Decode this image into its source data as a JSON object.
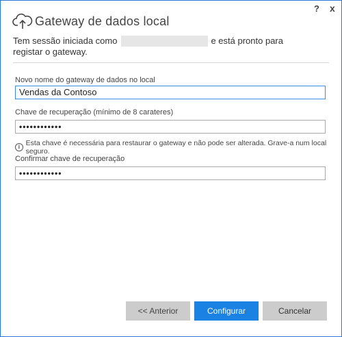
{
  "window": {
    "help_label": "?",
    "close_label": "x"
  },
  "header": {
    "title": "Gateway de dados local"
  },
  "signin": {
    "prefix": "Tem sessão iniciada como",
    "suffix": "e está pronto para",
    "line2": "registar o gateway."
  },
  "form": {
    "name_label": "Novo nome do gateway de dados no local",
    "name_value": "Vendas da Contoso",
    "key_label": "Chave de recuperação (mínimo de 8 carateres)",
    "key_value": "••••••••••••",
    "info_text": "Esta chave é necessária para restaurar o gateway e não pode ser alterada. Grave-a num local seguro.",
    "confirm_label": "Confirmar chave de recuperação",
    "confirm_value": "••••••••••••"
  },
  "buttons": {
    "previous": "<< Anterior",
    "configure": "Configurar",
    "cancel": "Cancelar"
  },
  "colors": {
    "accent": "#1a82e2",
    "border": "#2b78d6",
    "button_gray": "#cccccc"
  }
}
